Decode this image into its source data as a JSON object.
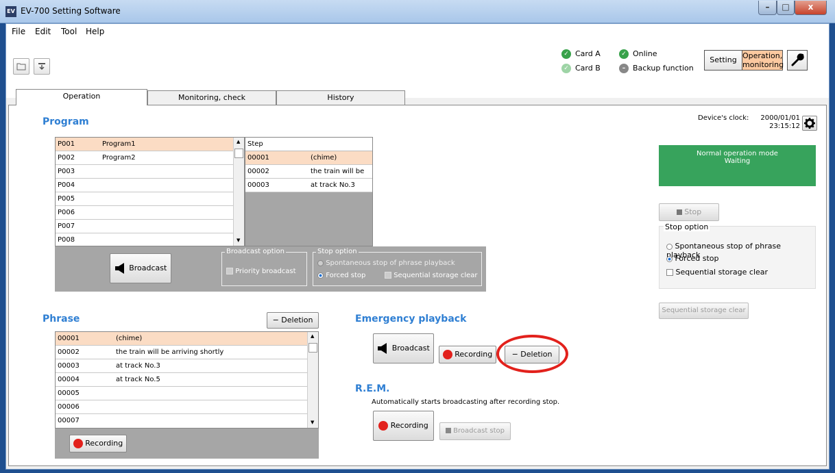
{
  "window": {
    "title": "EV-700 Setting Software",
    "app_icon_text": "EV",
    "controls": {
      "minimize": "–",
      "maximize": "□",
      "close": "x"
    }
  },
  "menu": [
    "File",
    "Edit",
    "Tool",
    "Help"
  ],
  "toolbar": {
    "open_icon": "folder-icon",
    "download_icon": "download-icon"
  },
  "status": {
    "card_a": "Card A",
    "card_b": "Card B",
    "online": "Online",
    "backup": "Backup function"
  },
  "mode_buttons": {
    "setting": "Setting",
    "operation": "Operation,\nmonitoring"
  },
  "tabs": [
    "Operation",
    "Monitoring, check",
    "History"
  ],
  "program": {
    "title": "Program",
    "items": [
      {
        "id": "P001",
        "name": "Program1"
      },
      {
        "id": "P002",
        "name": "Program2"
      },
      {
        "id": "P003",
        "name": ""
      },
      {
        "id": "P004",
        "name": ""
      },
      {
        "id": "P005",
        "name": ""
      },
      {
        "id": "P006",
        "name": ""
      },
      {
        "id": "P007",
        "name": ""
      },
      {
        "id": "P008",
        "name": ""
      }
    ],
    "step_header": "Step",
    "steps": [
      {
        "id": "00001",
        "text": "(chime)"
      },
      {
        "id": "00002",
        "text": "the train will be arriving shortly"
      },
      {
        "id": "00003",
        "text": "at track No.3"
      }
    ],
    "broadcast_label": "Broadcast",
    "broadcast_option_title": "Broadcast option",
    "priority_broadcast": "Priority broadcast",
    "stop_option_title": "Stop option",
    "spontaneous_stop": "Spontaneous stop of phrase playback",
    "forced_stop": "Forced stop",
    "sequential_clear": "Sequential storage clear"
  },
  "clock": {
    "label": "Device's clock:",
    "date": "2000/01/01",
    "time": "23:15:12"
  },
  "mode_status": {
    "line1": "Normal operation mode",
    "line2": "Waiting"
  },
  "right_panel": {
    "stop": "Stop",
    "stop_option": "Stop option",
    "spontaneous_stop": "Spontaneous stop of phrase playback",
    "forced_stop": "Forced stop",
    "sequential_clear": "Sequential storage clear",
    "sequential_clear_btn": "Sequential storage clear"
  },
  "phrase": {
    "title": "Phrase",
    "deletion": "Deletion",
    "items": [
      {
        "id": "00001",
        "text": "(chime)"
      },
      {
        "id": "00002",
        "text": "the train will be arriving shortly"
      },
      {
        "id": "00003",
        "text": "at track No.3"
      },
      {
        "id": "00004",
        "text": "at track No.5"
      },
      {
        "id": "00005",
        "text": ""
      },
      {
        "id": "00006",
        "text": ""
      },
      {
        "id": "00007",
        "text": ""
      }
    ],
    "recording": "Recording"
  },
  "emergency": {
    "title": "Emergency playback",
    "broadcast": "Broadcast",
    "recording": "Recording",
    "deletion": "Deletion"
  },
  "rem": {
    "title": "R.E.M.",
    "desc": "Automatically starts broadcasting after recording stop.",
    "recording": "Recording",
    "broadcast_stop": "Broadcast stop"
  },
  "colors": {
    "accent_blue": "#2f7fd3",
    "status_green": "#37a35c",
    "selection": "#fbdcc4",
    "highlight_red": "#e2211c"
  }
}
